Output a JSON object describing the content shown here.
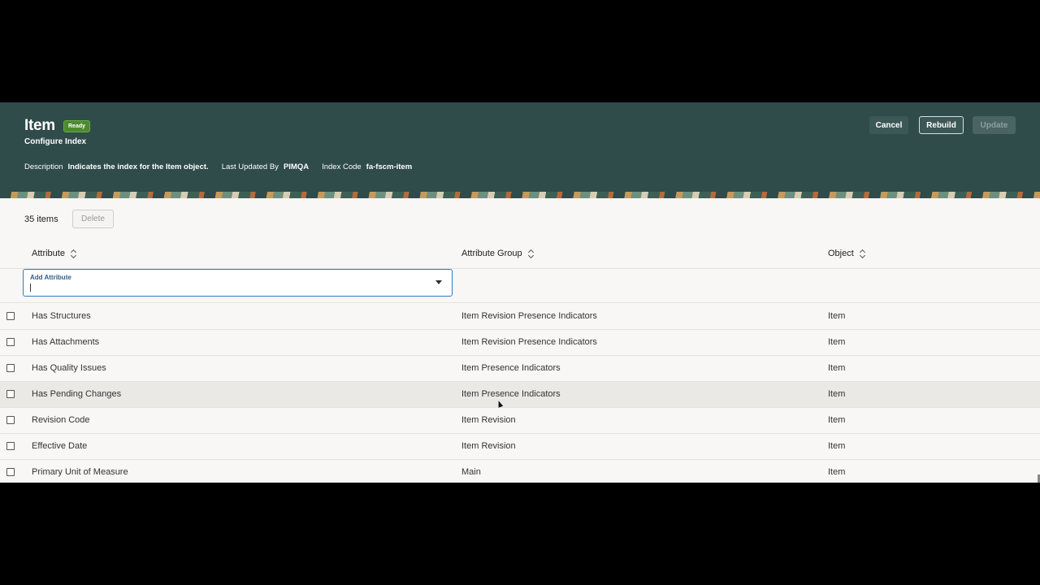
{
  "header": {
    "title": "Item",
    "status_badge": "Ready",
    "subtitle": "Configure Index",
    "description_label": "Description",
    "description_value": "Indicates the index for the Item object.",
    "updated_by_label": "Last Updated By",
    "updated_by_value": "PIMQA",
    "index_code_label": "Index Code",
    "index_code_value": "fa-fscm-item",
    "cancel_label": "Cancel",
    "rebuild_label": "Rebuild",
    "update_label": "Update"
  },
  "toolbar": {
    "count_text": "35 items",
    "delete_label": "Delete"
  },
  "table": {
    "columns": [
      "Attribute",
      "Attribute Group",
      "Object"
    ],
    "add_attribute_placeholder": "Add Attribute",
    "rows": [
      {
        "attribute": "Has Structures",
        "group": "Item Revision Presence Indicators",
        "object": "Item"
      },
      {
        "attribute": "Has Attachments",
        "group": "Item Revision Presence Indicators",
        "object": "Item"
      },
      {
        "attribute": "Has Quality Issues",
        "group": "Item Presence Indicators",
        "object": "Item"
      },
      {
        "attribute": "Has Pending Changes",
        "group": "Item Presence Indicators",
        "object": "Item"
      },
      {
        "attribute": "Revision Code",
        "group": "Item Revision",
        "object": "Item"
      },
      {
        "attribute": "Effective Date",
        "group": "Item Revision",
        "object": "Item"
      },
      {
        "attribute": "Primary Unit of Measure",
        "group": "Main",
        "object": "Item"
      }
    ]
  },
  "colors": {
    "header_bg": "#2f4b4a",
    "badge_green": "#4c8a2f",
    "focus_blue": "#2e7dba"
  }
}
